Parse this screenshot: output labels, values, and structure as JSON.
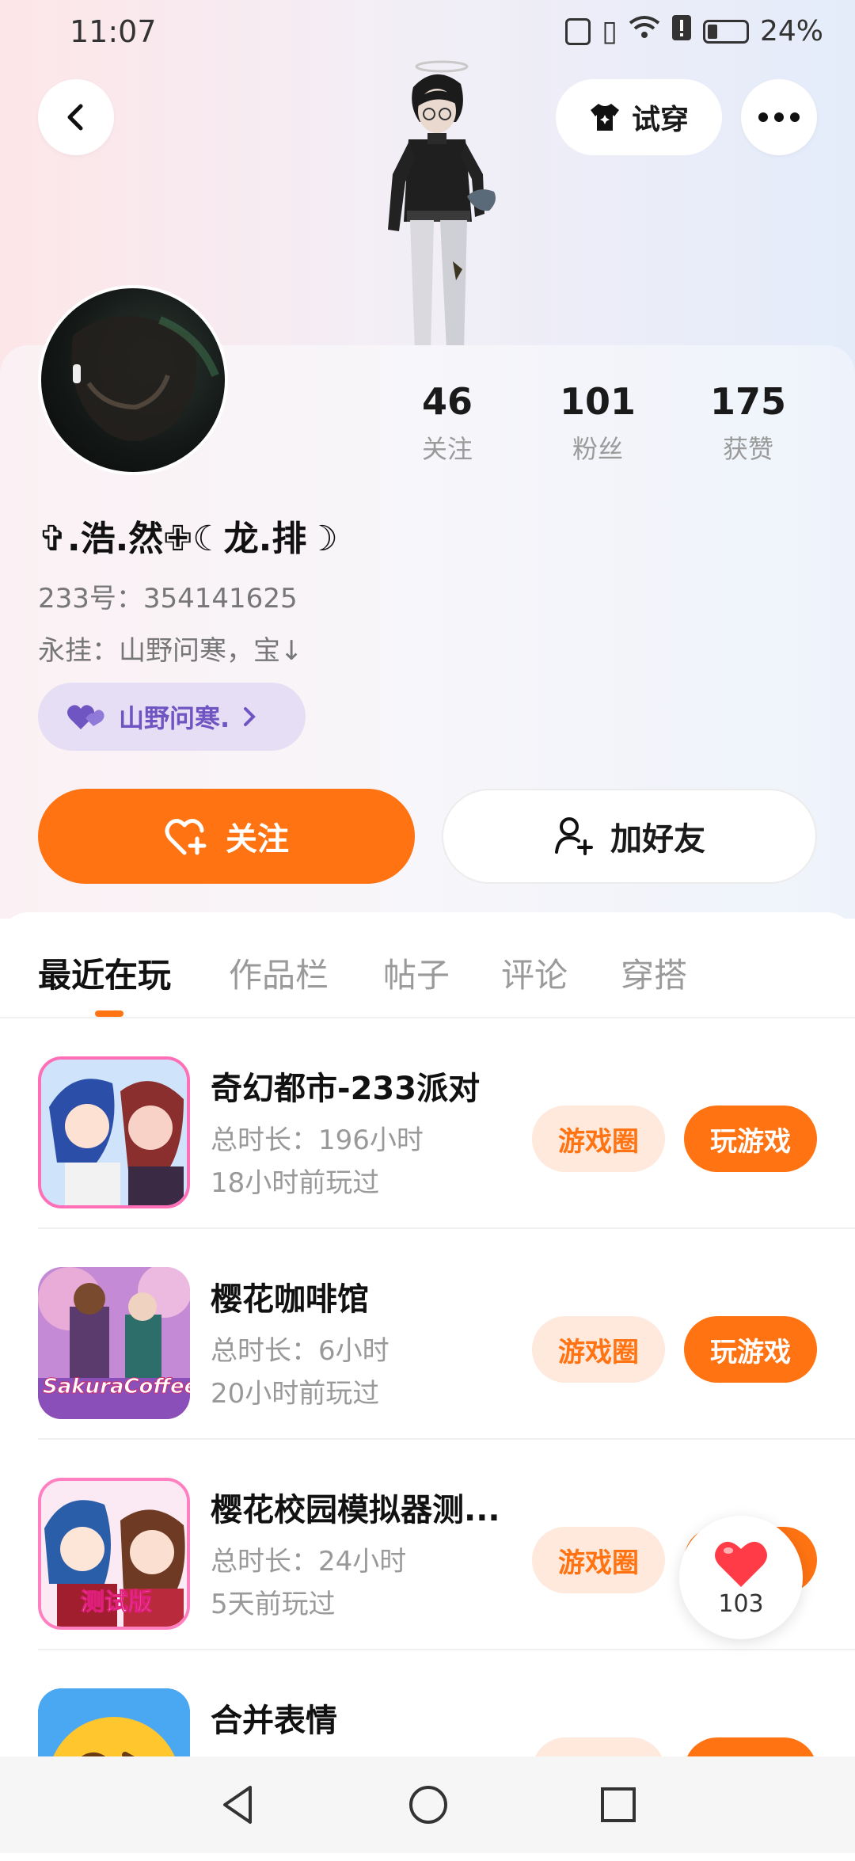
{
  "status_bar": {
    "time": "11:07",
    "battery": "24%"
  },
  "header": {
    "try_on_label": "试穿"
  },
  "profile": {
    "nickname": "✞.浩.然✙☾龙.排☽",
    "uid": "233号：354141625",
    "bio": "永挂：山野问寒，宝↓",
    "tag": "山野问寒.",
    "stats": [
      {
        "value": "46",
        "label": "关注"
      },
      {
        "value": "101",
        "label": "粉丝"
      },
      {
        "value": "175",
        "label": "获赞"
      }
    ]
  },
  "actions": {
    "follow_label": "关注",
    "add_friend_label": "加好友"
  },
  "tabs": [
    {
      "label": "最近在玩",
      "active": true
    },
    {
      "label": "作品栏",
      "active": false
    },
    {
      "label": "帖子",
      "active": false
    },
    {
      "label": "评论",
      "active": false
    },
    {
      "label": "穿搭",
      "active": false
    }
  ],
  "games": [
    {
      "name": "奇幻都市-233派对",
      "duration": "总时长：196小时",
      "last_played": "18小时前玩过",
      "icon": "party-game-icon"
    },
    {
      "name": "樱花咖啡馆",
      "duration": "总时长：6小时",
      "last_played": "20小时前玩过",
      "icon": "sakura-coffee-icon",
      "icon_text": "SakuraCoffee"
    },
    {
      "name": "樱花校园模拟器测...",
      "duration": "总时长：24小时",
      "last_played": "5天前玩过",
      "icon": "sakura-school-icon",
      "icon_text": "测试版"
    },
    {
      "name": "合并表情",
      "duration": "",
      "last_played": "",
      "icon": "emoji-merge-icon"
    }
  ],
  "game_buttons": {
    "circle_label": "游戏圈",
    "play_label": "玩游戏"
  },
  "floating_like": {
    "count": "103",
    "color": "#ff3b47"
  },
  "colors": {
    "accent": "#ff7312",
    "accent_light": "#ffe8dc",
    "tag_purple": "#6f55c2"
  }
}
